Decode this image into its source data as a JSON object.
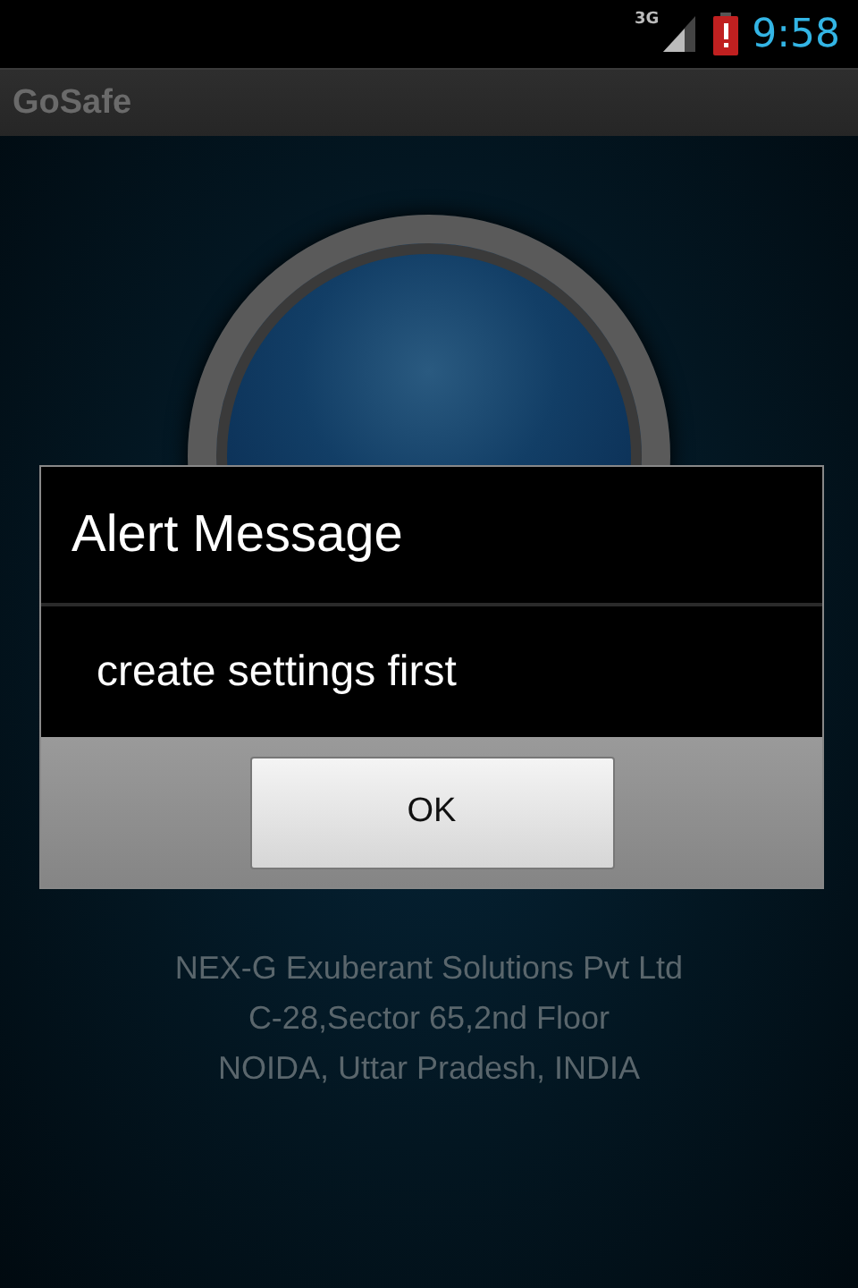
{
  "status_bar": {
    "network": "3G",
    "time": "9:58"
  },
  "app_bar": {
    "title": "GoSafe"
  },
  "address": [
    "NEX-G Exuberant Solutions Pvt Ltd",
    "C-28,Sector 65,2nd Floor",
    "NOIDA, Uttar Pradesh, INDIA"
  ],
  "dialog": {
    "title": "Alert Message",
    "message": "create settings first",
    "buttons": [
      "OK"
    ]
  }
}
